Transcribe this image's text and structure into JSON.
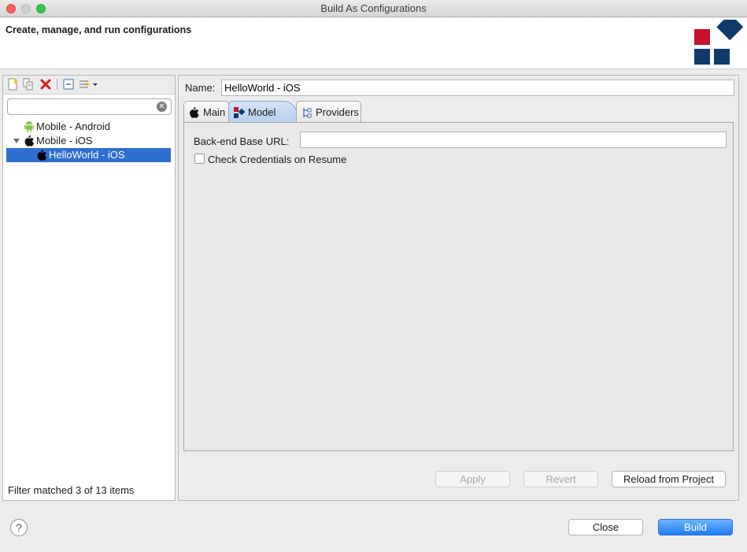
{
  "window": {
    "title": "Build As Configurations"
  },
  "banner": {
    "title": "Create, manage, and run configurations"
  },
  "left": {
    "filter": {
      "value": "",
      "placeholder": ""
    },
    "tree": [
      {
        "label": "Mobile - Android",
        "icon": "android-icon"
      },
      {
        "label": "Mobile - iOS",
        "icon": "apple-icon",
        "expanded": true
      },
      {
        "label": "HelloWorld - iOS",
        "icon": "apple-icon",
        "selected": true
      }
    ],
    "status": "Filter matched 3 of 13 items"
  },
  "right": {
    "name_label": "Name:",
    "name_value": "HelloWorld - iOS",
    "tabs": [
      {
        "label": "Main",
        "icon": "apple-icon"
      },
      {
        "label": "Model",
        "icon": "model-icon",
        "active": true
      },
      {
        "label": "Providers",
        "icon": "providers-icon"
      }
    ],
    "model": {
      "url_label": "Back-end Base URL:",
      "url_value": "",
      "check_label": "Check Credentials on Resume",
      "check_checked": false
    },
    "buttons": {
      "apply": "Apply",
      "revert": "Revert",
      "reload": "Reload from Project"
    }
  },
  "footer": {
    "help": "?",
    "close": "Close",
    "build": "Build"
  },
  "colors": {
    "selection": "#2f6fd1",
    "primary": "#1e7cf5",
    "logo_red": "#c8102e",
    "logo_blue": "#0f3a6b"
  }
}
